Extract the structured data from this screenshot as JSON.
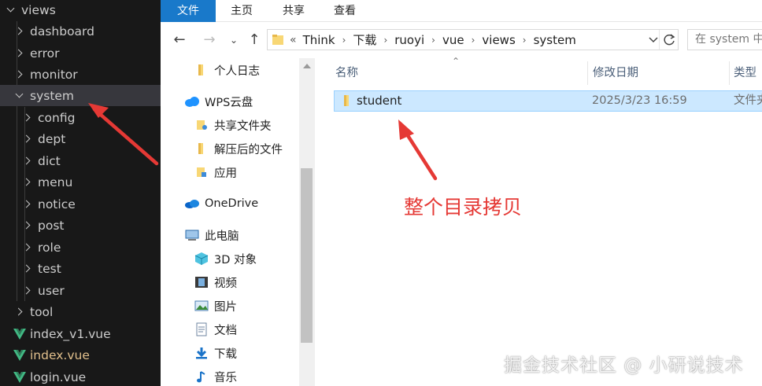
{
  "editor_tree": {
    "items": [
      {
        "label": "views",
        "expanded": true,
        "kind": "folder"
      },
      {
        "label": "dashboard",
        "expanded": false,
        "kind": "folder"
      },
      {
        "label": "error",
        "expanded": false,
        "kind": "folder"
      },
      {
        "label": "monitor",
        "expanded": false,
        "kind": "folder"
      },
      {
        "label": "system",
        "expanded": true,
        "kind": "folder",
        "selected": true
      },
      {
        "label": "config",
        "expanded": false,
        "kind": "folder"
      },
      {
        "label": "dept",
        "expanded": false,
        "kind": "folder"
      },
      {
        "label": "dict",
        "expanded": false,
        "kind": "folder"
      },
      {
        "label": "menu",
        "expanded": false,
        "kind": "folder"
      },
      {
        "label": "notice",
        "expanded": false,
        "kind": "folder"
      },
      {
        "label": "post",
        "expanded": false,
        "kind": "folder"
      },
      {
        "label": "role",
        "expanded": false,
        "kind": "folder"
      },
      {
        "label": "test",
        "expanded": false,
        "kind": "folder"
      },
      {
        "label": "user",
        "expanded": false,
        "kind": "folder"
      },
      {
        "label": "tool",
        "expanded": false,
        "kind": "folder"
      },
      {
        "label": "index_v1.vue",
        "kind": "vue-file"
      },
      {
        "label": "index.vue",
        "kind": "vue-file"
      },
      {
        "label": "login.vue",
        "kind": "vue-file"
      }
    ]
  },
  "ribbon": {
    "tabs": [
      "文件",
      "主页",
      "共享",
      "查看"
    ],
    "active_tab_color": "#1979ca"
  },
  "address": {
    "prefix": "«",
    "crumbs": [
      "Think",
      "下载",
      "ruoyi",
      "vue",
      "views",
      "system"
    ],
    "search_placeholder": "在 system 中"
  },
  "nav_pane": {
    "items": [
      {
        "label": "个人日志",
        "icon": "folder-pin-icon"
      },
      {
        "label": "WPS云盘",
        "icon": "cloud-icon"
      },
      {
        "label": "共享文件夹",
        "icon": "shared-folder-icon"
      },
      {
        "label": "解压后的文件",
        "icon": "folder-icon"
      },
      {
        "label": "应用",
        "icon": "app-folder-icon"
      },
      {
        "label": "OneDrive",
        "icon": "onedrive-icon"
      },
      {
        "label": "此电脑",
        "icon": "pc-icon"
      },
      {
        "label": "3D 对象",
        "icon": "cube-icon"
      },
      {
        "label": "视频",
        "icon": "video-icon"
      },
      {
        "label": "图片",
        "icon": "picture-icon"
      },
      {
        "label": "文档",
        "icon": "document-icon"
      },
      {
        "label": "下载",
        "icon": "download-icon"
      },
      {
        "label": "音乐",
        "icon": "music-icon"
      }
    ]
  },
  "file_list": {
    "columns": [
      "名称",
      "修改日期",
      "类型"
    ],
    "rows": [
      {
        "name": "student",
        "modified": "2025/3/23 16:59",
        "type": "文件夹"
      }
    ]
  },
  "annotation": {
    "callout": "整个目录拷贝",
    "color": "#e53935"
  },
  "watermark": "掘金技术社区 @ 小研说技术"
}
